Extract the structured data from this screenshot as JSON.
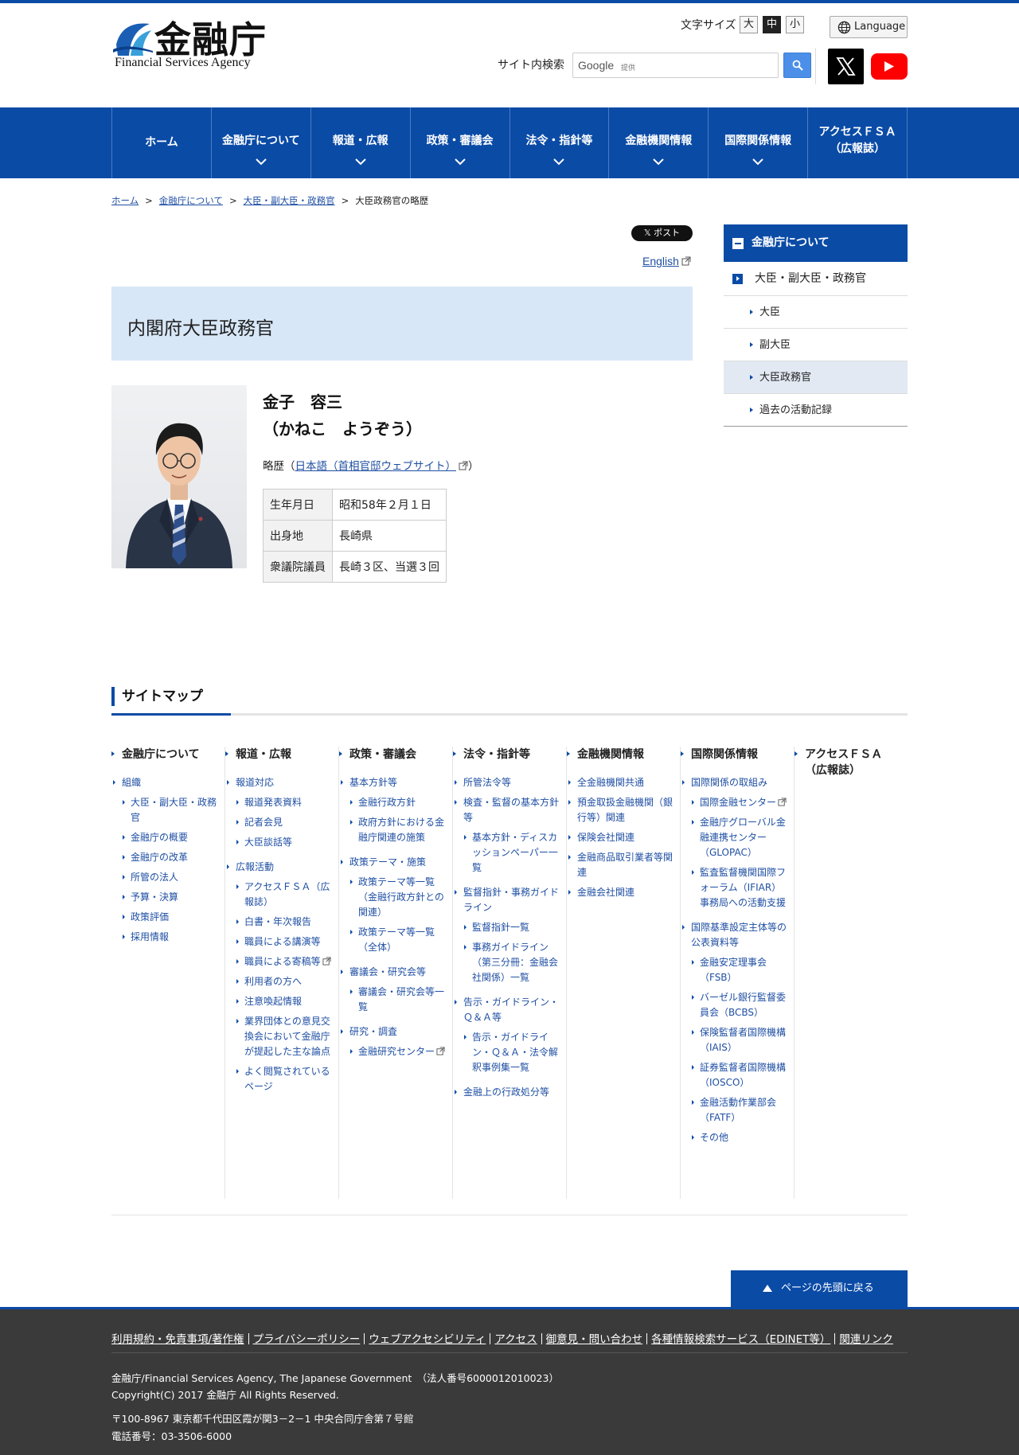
{
  "header": {
    "logo_jp": "金融庁",
    "logo_en": "Financial Services Agency",
    "font_size_label": "文字サイズ",
    "font_sizes": [
      "大",
      "中",
      "小"
    ],
    "language_label": "Language",
    "search_label": "サイト内検索",
    "search_brand": "Google",
    "search_provided": "提供"
  },
  "nav": {
    "items": [
      {
        "label": "ホーム"
      },
      {
        "label": "金融庁について"
      },
      {
        "label": "報道・広報"
      },
      {
        "label": "政策・審議会"
      },
      {
        "label": "法令・指針等"
      },
      {
        "label": "金融機関情報"
      },
      {
        "label": "国際関係情報"
      },
      {
        "label": "アクセスＦＳＡ",
        "label2": "（広報誌）"
      }
    ]
  },
  "breadcrumb": [
    "ホーム",
    "金融庁について",
    "大臣・副大臣・政務官",
    "大臣政務官の略歴"
  ],
  "main": {
    "post_label": "𝕏 ポスト",
    "english_label": "English",
    "page_title": "内閣府大臣政務官",
    "name": "金子　容三",
    "name_kana": "（かねこ　ようぞう）",
    "career_prefix": "略歴（",
    "career_link": "日本語（首相官邸ウェブサイト）",
    "career_suffix": "）",
    "profile": [
      {
        "label": "生年月日",
        "value": "昭和58年２月１日"
      },
      {
        "label": "出身地",
        "value": "長崎県"
      },
      {
        "label": "衆議院議員",
        "value": "長崎３区、当選３回"
      }
    ]
  },
  "sidenav": {
    "head": "金融庁について",
    "l1": "大臣・副大臣・政務官",
    "items": [
      "大臣",
      "副大臣",
      "大臣政務官",
      "過去の活動記録"
    ]
  },
  "sitemap": {
    "title": "サイトマップ",
    "columns": [
      {
        "head": "金融庁について",
        "items": [
          {
            "t": "組織",
            "lvl": 1
          },
          {
            "t": "大臣・副大臣・政務官",
            "lvl": 2
          },
          {
            "t": "金融庁の概要",
            "lvl": 2
          },
          {
            "t": "金融庁の改革",
            "lvl": 2
          },
          {
            "t": "所管の法人",
            "lvl": 2
          },
          {
            "t": "予算・決算",
            "lvl": 2
          },
          {
            "t": "政策評価",
            "lvl": 2
          },
          {
            "t": "採用情報",
            "lvl": 2
          }
        ]
      },
      {
        "head": "報道・広報",
        "items": [
          {
            "t": "報道対応",
            "lvl": 1
          },
          {
            "t": "報道発表資料",
            "lvl": 2
          },
          {
            "t": "記者会見",
            "lvl": 2
          },
          {
            "t": "大臣談話等",
            "lvl": 2
          },
          {
            "t": "広報活動",
            "lvl": 1,
            "gap": true
          },
          {
            "t": "アクセスＦＳＡ（広報誌）",
            "lvl": 2
          },
          {
            "t": "白書・年次報告",
            "lvl": 2
          },
          {
            "t": "職員による講演等",
            "lvl": 2
          },
          {
            "t": "職員による寄稿等",
            "lvl": 2,
            "ext": true
          },
          {
            "t": "利用者の方へ",
            "lvl": 2
          },
          {
            "t": "注意喚起情報",
            "lvl": 2
          },
          {
            "t": "業界団体との意見交換会において金融庁が提起した主な論点",
            "lvl": 2
          },
          {
            "t": "よく閲覧されているページ",
            "lvl": 2
          }
        ]
      },
      {
        "head": "政策・審議会",
        "items": [
          {
            "t": "基本方針等",
            "lvl": 1
          },
          {
            "t": "金融行政方針",
            "lvl": 2
          },
          {
            "t": "政府方針における金融庁関連の施策",
            "lvl": 2
          },
          {
            "t": "政策テーマ・施策",
            "lvl": 1,
            "gap": true
          },
          {
            "t": "政策テーマ等一覧（金融行政方針との関連）",
            "lvl": 2
          },
          {
            "t": "政策テーマ等一覧（全体）",
            "lvl": 2
          },
          {
            "t": "審議会・研究会等",
            "lvl": 1,
            "gap": true
          },
          {
            "t": "審議会・研究会等一覧",
            "lvl": 2
          },
          {
            "t": "研究・調査",
            "lvl": 1,
            "gap": true
          },
          {
            "t": "金融研究センター",
            "lvl": 2,
            "ext": true
          }
        ]
      },
      {
        "head": "法令・指針等",
        "items": [
          {
            "t": "所管法令等",
            "lvl": 1
          },
          {
            "t": "検査・監督の基本方針等",
            "lvl": 1
          },
          {
            "t": "基本方針・ディスカッションペーパー一覧",
            "lvl": 2
          },
          {
            "t": "監督指針・事務ガイドライン",
            "lvl": 1,
            "gap": true
          },
          {
            "t": "監督指針一覧",
            "lvl": 2
          },
          {
            "t": "事務ガイドライン（第三分冊：金融会社関係）一覧",
            "lvl": 2
          },
          {
            "t": "告示・ガイドライン・Ｑ＆Ａ等",
            "lvl": 1,
            "gap": true
          },
          {
            "t": "告示・ガイドライン・Ｑ＆Ａ・法令解釈事例集一覧",
            "lvl": 2
          },
          {
            "t": "金融上の行政処分等",
            "lvl": 1,
            "gap": true
          }
        ]
      },
      {
        "head": "金融機関情報",
        "items": [
          {
            "t": "全金融機関共通",
            "lvl": 1
          },
          {
            "t": "預金取扱金融機関（銀行等）関連",
            "lvl": 1
          },
          {
            "t": "保険会社関連",
            "lvl": 1
          },
          {
            "t": "金融商品取引業者等関連",
            "lvl": 1
          },
          {
            "t": "金融会社関連",
            "lvl": 1
          }
        ]
      },
      {
        "head": "国際関係情報",
        "items": [
          {
            "t": "国際関係の取組み",
            "lvl": 1
          },
          {
            "t": "国際金融センター",
            "lvl": 2,
            "ext": true
          },
          {
            "t": "金融庁グローバル金融連携センター（GLOPAC）",
            "lvl": 2
          },
          {
            "t": "監査監督機関国際フォーラム（IFIAR）事務局への活動支援",
            "lvl": 2
          },
          {
            "t": "国際基準設定主体等の公表資料等",
            "lvl": 1,
            "gap": true
          },
          {
            "t": "金融安定理事会（FSB）",
            "lvl": 2
          },
          {
            "t": "バーゼル銀行監督委員会（BCBS）",
            "lvl": 2
          },
          {
            "t": "保険監督者国際機構（IAIS）",
            "lvl": 2
          },
          {
            "t": "証券監督者国際機構（IOSCO）",
            "lvl": 2
          },
          {
            "t": "金融活動作業部会（FATF）",
            "lvl": 2
          },
          {
            "t": "その他",
            "lvl": 2
          }
        ]
      },
      {
        "head": "アクセスＦＳＡ（広報誌）",
        "items": []
      }
    ]
  },
  "totop_label": "ページの先頭に戻る",
  "footer": {
    "links": [
      "利用規約・免責事項/著作権",
      "プライバシーポリシー",
      "ウェブアクセシビリティ",
      "アクセス",
      "御意見・問い合わせ",
      "各種情報検索サービス（EDINET等）",
      "関連リンク"
    ],
    "agency": "金融庁/Financial Services Agency, The Japanese Government　（法人番号6000012010023）",
    "copyright": "Copyright(C) 2017 金融庁 All Rights Reserved.",
    "address": "〒100-8967 東京都千代田区霞が関3－2－1 中央合同庁舎第７号館",
    "phone": "電話番号：03-3506-6000"
  },
  "colors": {
    "brand": "#0a4ba6",
    "title_bg": "#d8e7f7",
    "footer_bg": "#3a3a3a"
  }
}
